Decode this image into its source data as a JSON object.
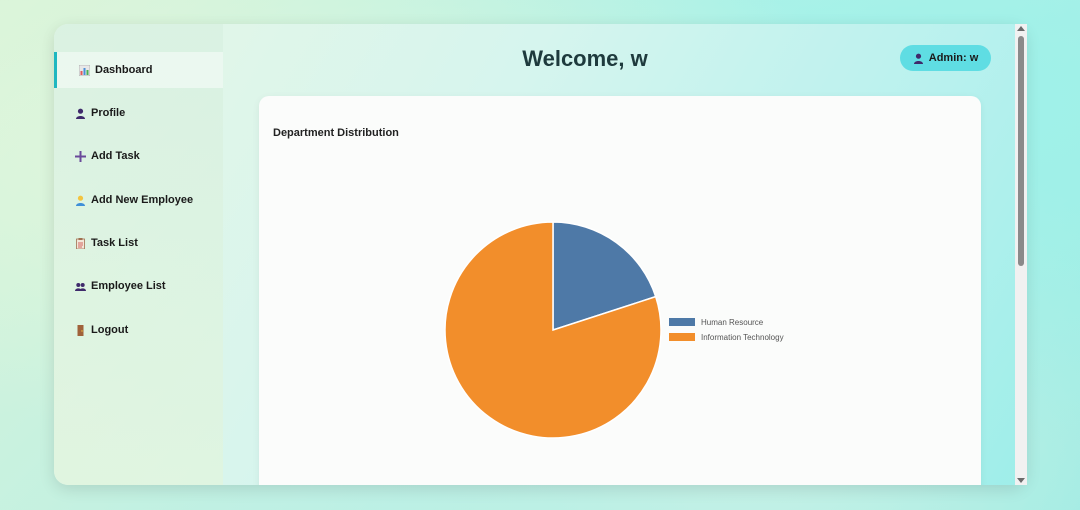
{
  "sidebar": {
    "items": [
      {
        "label": "Dashboard",
        "icon": "chart-icon"
      },
      {
        "label": "Profile",
        "icon": "user-icon"
      },
      {
        "label": "Add Task",
        "icon": "plus-icon"
      },
      {
        "label": "Add New Employee",
        "icon": "person-add-icon"
      },
      {
        "label": "Task List",
        "icon": "clipboard-icon"
      },
      {
        "label": "Employee List",
        "icon": "users-icon"
      },
      {
        "label": "Logout",
        "icon": "door-icon"
      }
    ]
  },
  "header": {
    "title": "Welcome, w",
    "admin_label": "Admin: w"
  },
  "card": {
    "title": "Department Distribution"
  },
  "colors": {
    "accent": "#1fb7c0",
    "badge": "#5fdde3"
  },
  "chart_data": {
    "type": "pie",
    "categories": [
      "Human Resource",
      "Information Technology"
    ],
    "values": [
      1,
      4
    ],
    "colors": [
      "#4e79a7",
      "#f28e2b"
    ],
    "legend": "right"
  }
}
